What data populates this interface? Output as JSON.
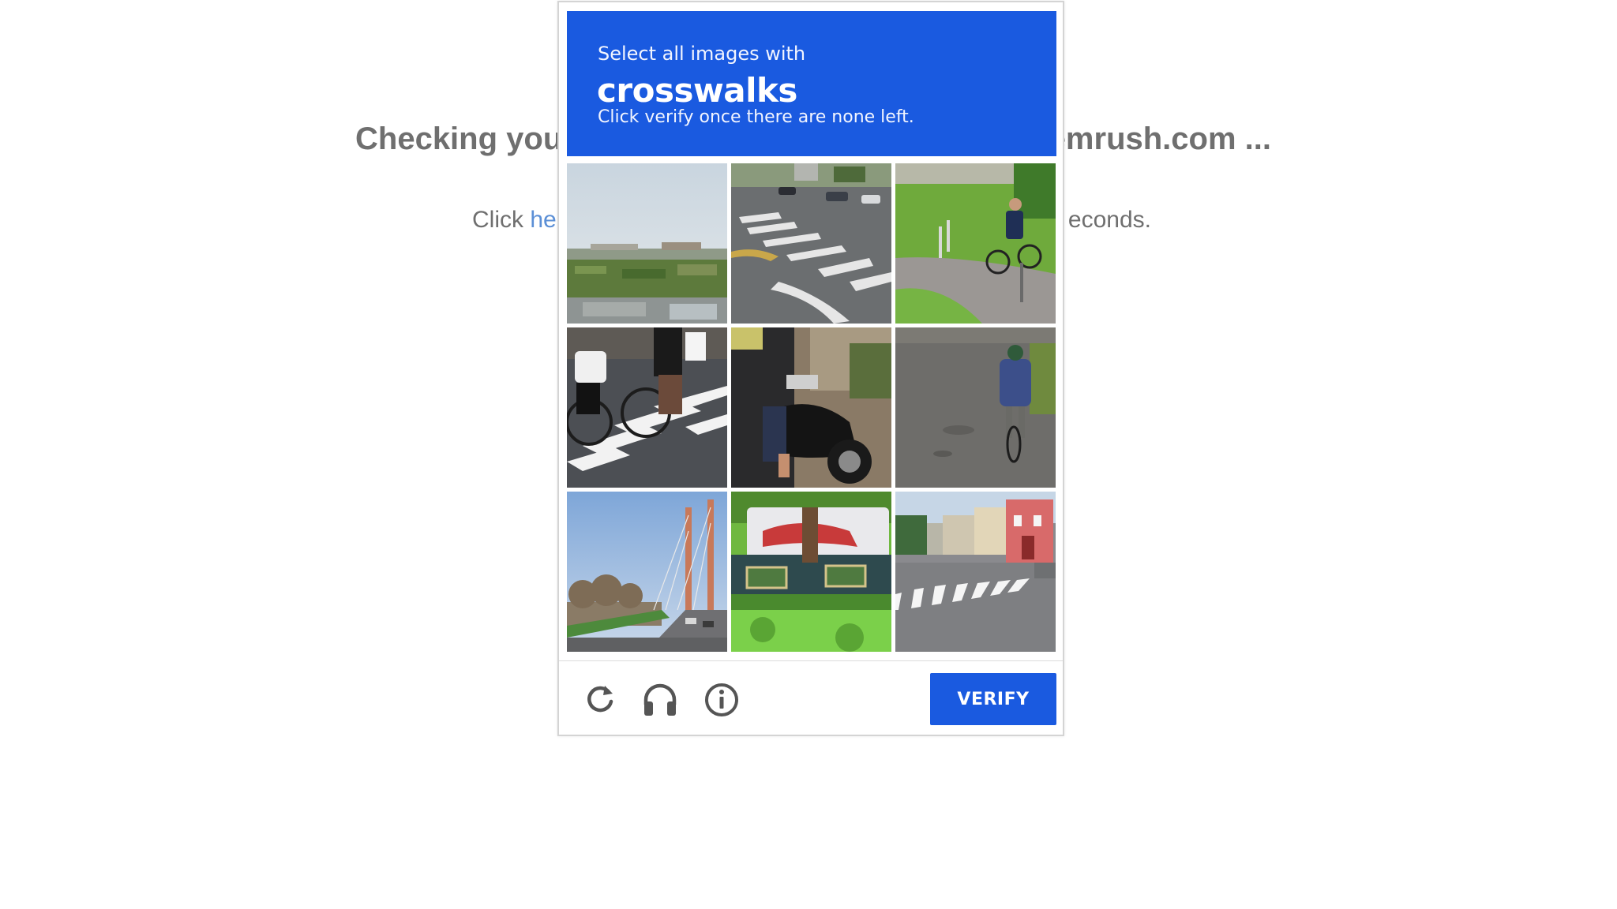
{
  "background": {
    "heading_left": "Checking you",
    "heading_right": "emrush.com ...",
    "sub_prefix": "Click ",
    "sub_link": "he",
    "sub_suffix": "econds."
  },
  "captcha": {
    "prompt_line1": "Select all images with",
    "prompt_keyword": "crosswalks",
    "prompt_line3": "Click verify once there are none left.",
    "accent_color": "#1a5ae0",
    "tiles": [
      {
        "subject": "rooftop-garden-city-view",
        "selected": false
      },
      {
        "subject": "intersection-with-crosswalk",
        "selected": false
      },
      {
        "subject": "cyclist-on-path-by-grass",
        "selected": false
      },
      {
        "subject": "cyclists-on-zebra-crossing",
        "selected": false
      },
      {
        "subject": "motorcycle-rider",
        "selected": false
      },
      {
        "subject": "cyclist-on-road",
        "selected": false
      },
      {
        "subject": "cable-stayed-bridge",
        "selected": false
      },
      {
        "subject": "bus-behind-trees",
        "selected": false
      },
      {
        "subject": "street-with-crosswalk-houses",
        "selected": false
      }
    ],
    "footer": {
      "reload_icon": "reload-icon",
      "audio_icon": "headphones-icon",
      "info_icon": "info-icon",
      "verify_label": "VERIFY"
    }
  }
}
